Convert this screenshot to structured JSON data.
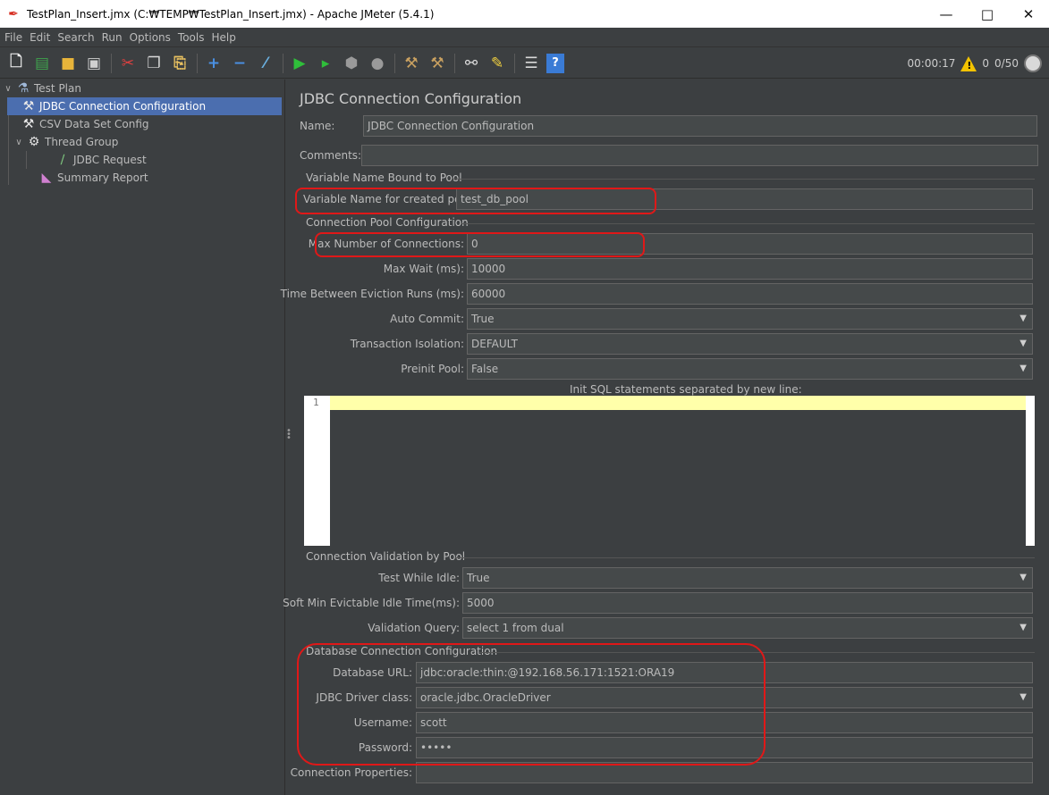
{
  "window": {
    "title": "TestPlan_Insert.jmx (C:₩TEMP₩TestPlan_Insert.jmx) - Apache JMeter (5.4.1)",
    "minimize": "—",
    "maximize": "□",
    "close": "✕"
  },
  "menu": [
    "File",
    "Edit",
    "Search",
    "Run",
    "Options",
    "Tools",
    "Help"
  ],
  "toolbar": {
    "elapsed": "00:00:17",
    "warnings": "0",
    "threads": "0/50"
  },
  "tree": {
    "test_plan": "Test Plan",
    "jdbc_config": "JDBC Connection Configuration",
    "csv_config": "CSV Data Set Config",
    "thread_group": "Thread Group",
    "jdbc_request": "JDBC Request",
    "summary_report": "Summary Report"
  },
  "panel": {
    "title": "JDBC Connection Configuration",
    "name_label": "Name:",
    "name_value": "JDBC Connection Configuration",
    "comments_label": "Comments:",
    "comments_value": "",
    "pool_var_group": "Variable Name Bound to Pool",
    "pool_var_label": "Variable Name for created pool:",
    "pool_var_value": "test_db_pool",
    "pool_cfg_group": "Connection Pool Configuration",
    "max_conn_label": "Max Number of Connections:",
    "max_conn_value": "0",
    "max_wait_label": "Max Wait (ms):",
    "max_wait_value": "10000",
    "eviction_label": "Time Between Eviction Runs (ms):",
    "eviction_value": "60000",
    "auto_commit_label": "Auto Commit:",
    "auto_commit_value": "True",
    "tx_iso_label": "Transaction Isolation:",
    "tx_iso_value": "DEFAULT",
    "preinit_label": "Preinit Pool:",
    "preinit_value": "False",
    "init_sql_label": "Init SQL statements separated by new line:",
    "line_number": "1",
    "validation_group": "Connection Validation by Pool",
    "test_idle_label": "Test While Idle:",
    "test_idle_value": "True",
    "soft_min_label": "Soft Min Evictable Idle Time(ms):",
    "soft_min_value": "5000",
    "val_query_label": "Validation Query:",
    "val_query_value": "select 1 from dual",
    "db_group": "Database Connection Configuration",
    "db_url_label": "Database URL:",
    "db_url_value": "jdbc:oracle:thin:@192.168.56.171:1521:ORA19",
    "driver_label": "JDBC Driver class:",
    "driver_value": "oracle.jdbc.OracleDriver",
    "username_label": "Username:",
    "username_value": "scott",
    "password_label": "Password:",
    "password_value": "•••••",
    "conn_props_label": "Connection Properties:",
    "conn_props_value": ""
  },
  "colors": {
    "background": "#3c3f41",
    "field": "#45494a",
    "selection": "#4b6eaf",
    "highlight": "#e01818",
    "editor_current_line": "#ffffaa"
  }
}
